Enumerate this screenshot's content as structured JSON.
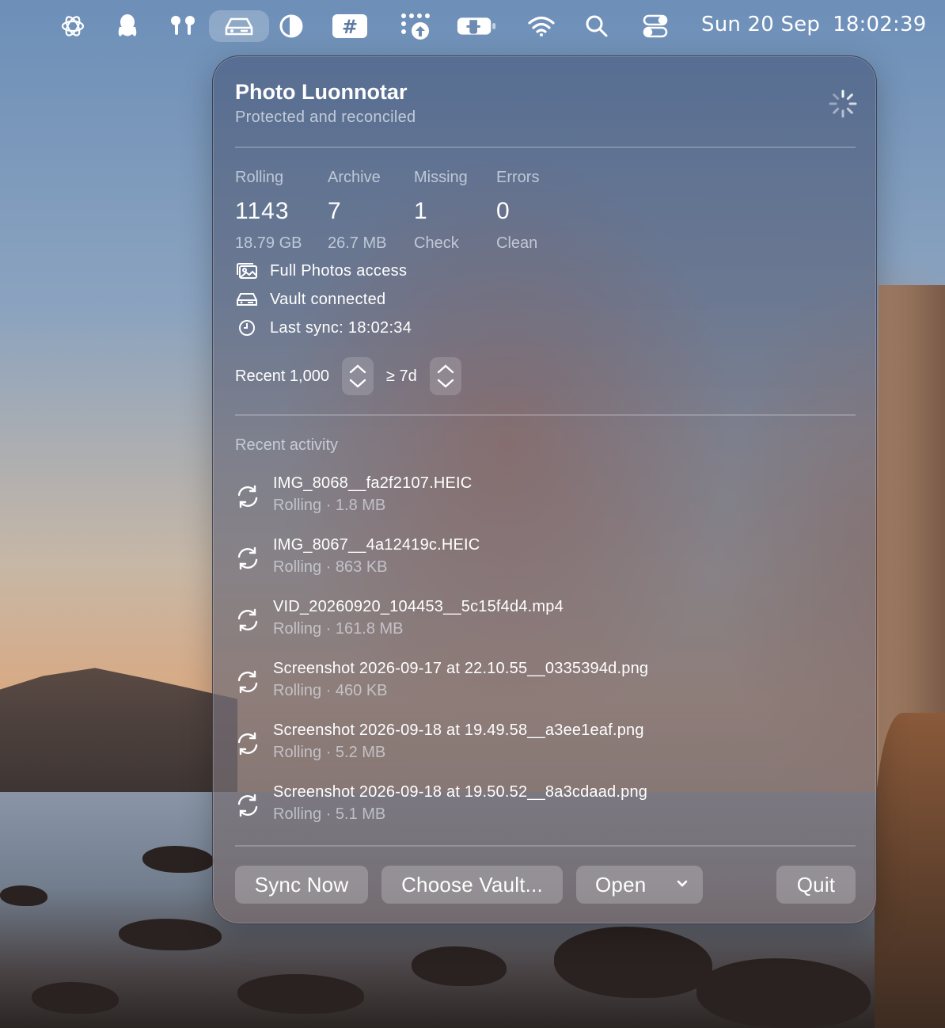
{
  "menubar": {
    "icons": [
      "chatgpt-icon",
      "qq-penguin-icon",
      "airpods-icon",
      "drive-icon",
      "contrast-icon",
      "hashtag-icon",
      "apps-upload-icon",
      "battery-charging-icon",
      "wifi-icon",
      "search-icon",
      "control-center-icon"
    ],
    "date": "Sun 20 Sep",
    "time": "18:02:39"
  },
  "panel": {
    "title": "Photo Luonnotar",
    "subtitle": "Protected and reconciled",
    "stats": [
      {
        "label": "Rolling",
        "value": "1143",
        "sub": "18.79 GB"
      },
      {
        "label": "Archive",
        "value": "7",
        "sub": "26.7 MB"
      },
      {
        "label": "Missing",
        "value": "1",
        "sub": "Check"
      },
      {
        "label": "Errors",
        "value": "0",
        "sub": "Clean"
      }
    ],
    "status": {
      "photos_access": "Full Photos access",
      "vault": "Vault connected",
      "last_sync": "Last sync: 18:02:34"
    },
    "recent_count": "Recent 1,000",
    "age_threshold": "≥ 7d",
    "activity_label": "Recent activity",
    "activity": [
      {
        "name": "IMG_8068__fa2f2107.HEIC",
        "meta": "Rolling · 1.8 MB"
      },
      {
        "name": "IMG_8067__4a12419c.HEIC",
        "meta": "Rolling · 863 KB"
      },
      {
        "name": "VID_20260920_104453__5c15f4d4.mp4",
        "meta": "Rolling · 161.8 MB"
      },
      {
        "name": "Screenshot 2026-09-17 at 22.10.55__0335394d.png",
        "meta": "Rolling · 460 KB"
      },
      {
        "name": "Screenshot 2026-09-18 at 19.49.58__a3ee1eaf.png",
        "meta": "Rolling · 5.2 MB"
      },
      {
        "name": "Screenshot 2026-09-18 at 19.50.52__8a3cdaad.png",
        "meta": "Rolling · 5.1 MB"
      }
    ],
    "buttons": {
      "sync": "Sync Now",
      "choose_vault": "Choose Vault...",
      "open": "Open",
      "quit": "Quit"
    }
  }
}
